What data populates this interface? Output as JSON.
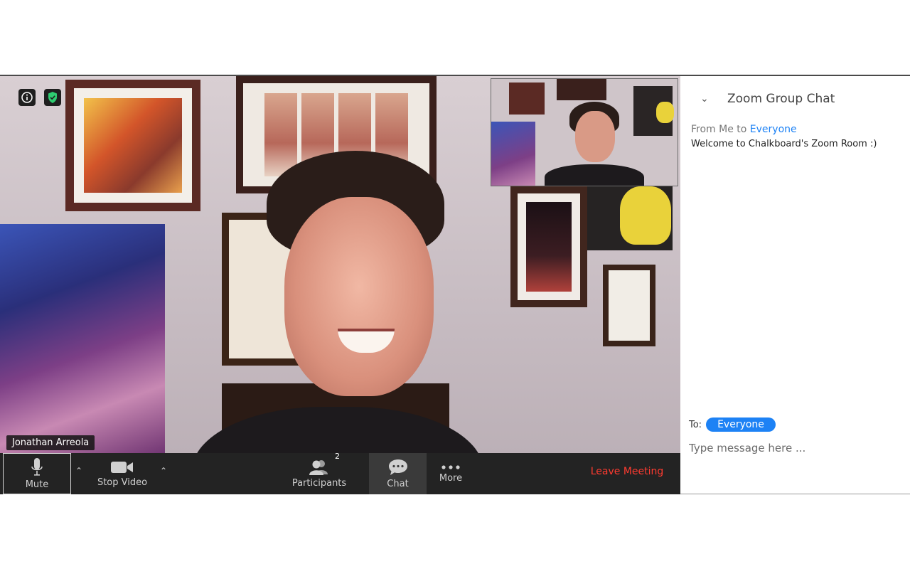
{
  "video": {
    "speaker_name": "Jonathan Arreola"
  },
  "toolbar": {
    "mute_label": "Mute",
    "stop_video_label": "Stop Video",
    "participants_label": "Participants",
    "participant_count": "2",
    "chat_label": "Chat",
    "more_label": "More",
    "leave_label": "Leave Meeting"
  },
  "chat": {
    "title": "Zoom Group Chat",
    "messages": [
      {
        "from_prefix": "From Me to ",
        "to": "Everyone",
        "text": "Welcome to Chalkboard's Zoom Room :)"
      }
    ],
    "to_label": "To:",
    "recipient": "Everyone",
    "input_placeholder": "Type message here ..."
  },
  "colors": {
    "accent_blue": "#1d82f5",
    "leave_red": "#ff3b30",
    "toolbar_bg": "#232323",
    "shield_green": "#2ecc71"
  },
  "icons": [
    "info-icon",
    "shield-icon",
    "microphone-icon",
    "camera-icon",
    "participants-icon",
    "chat-bubble-icon",
    "more-dots-icon",
    "chevron-up-icon",
    "chevron-down-icon"
  ]
}
